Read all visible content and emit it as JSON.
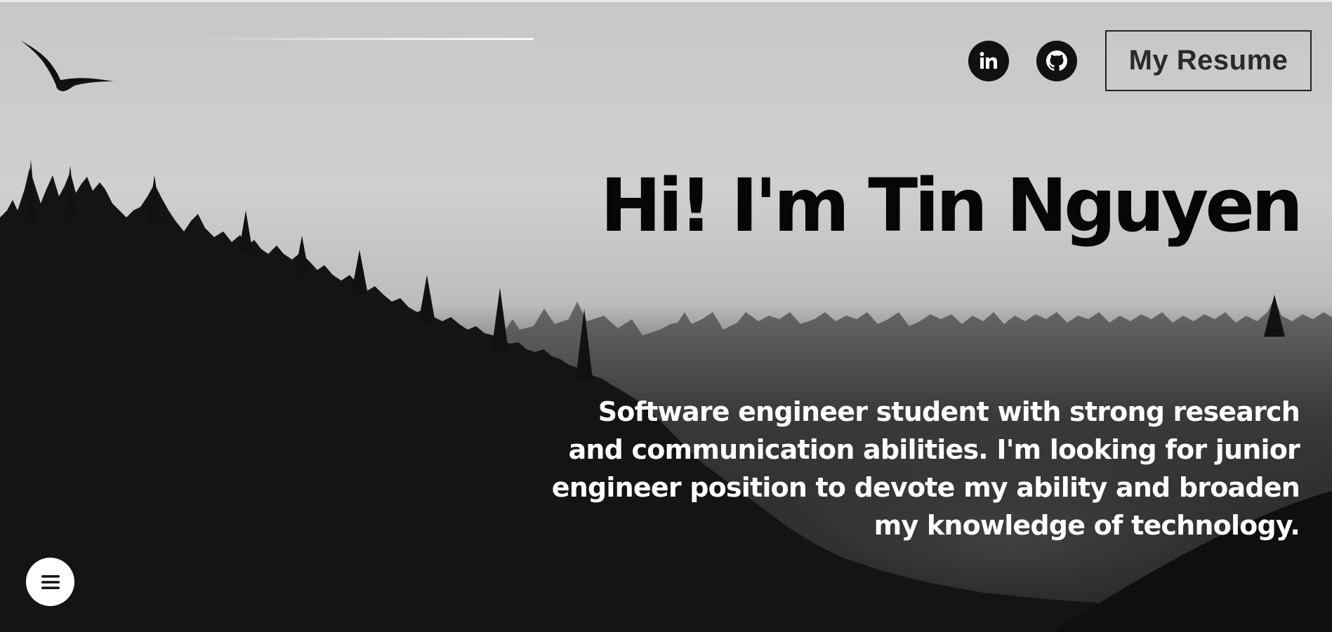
{
  "header": {
    "logo_icon": "bird-icon",
    "social": [
      {
        "name": "LinkedIn",
        "icon": "linkedin-icon"
      },
      {
        "name": "GitHub",
        "icon": "github-icon"
      }
    ],
    "resume_label": "My Resume"
  },
  "hero": {
    "title": "Hi! I'm Tin Nguyen",
    "bio": "Software engineer student with strong research and communication abilities. I'm looking for junior engineer position to devote my ability and broaden my knowledge of technology."
  },
  "menu": {
    "icon": "hamburger-menu-icon"
  },
  "colors": {
    "sky": "#c7c7c7",
    "forest": "#121212",
    "title_text": "#060606",
    "bio_text": "#ffffff",
    "menu_button": "#ffffff"
  }
}
